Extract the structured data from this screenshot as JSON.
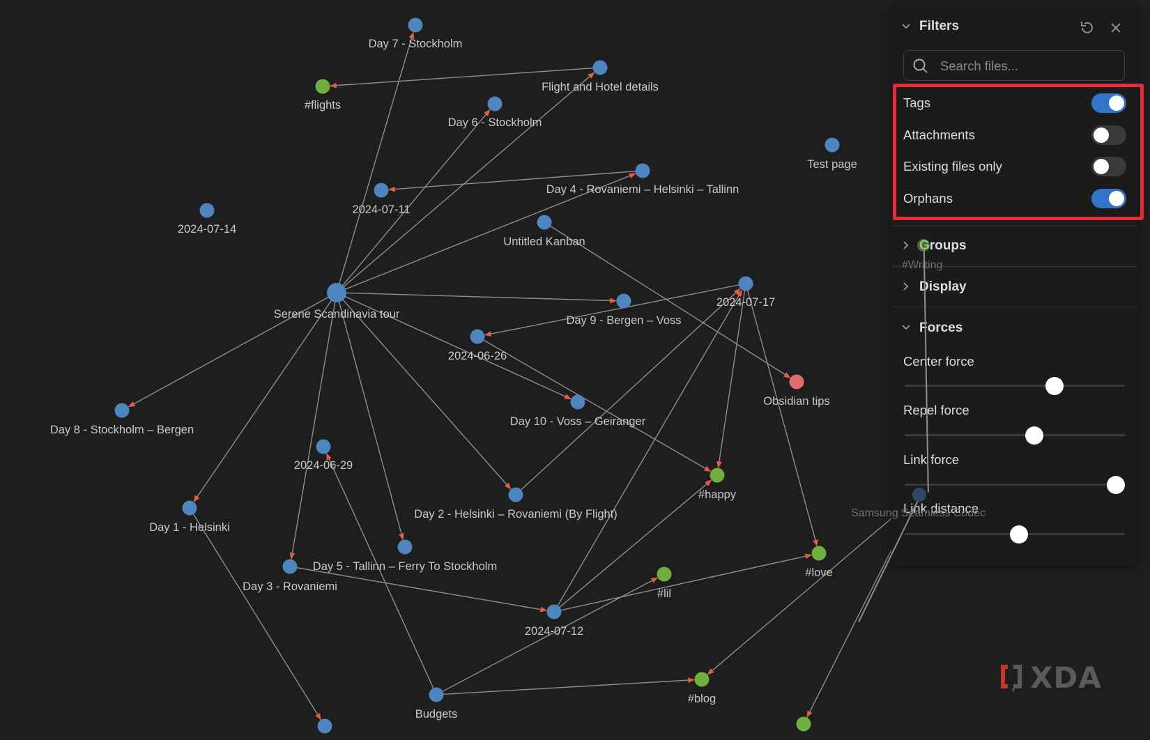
{
  "colors": {
    "background": "#1e1e1e",
    "node_note": "#4f86bf",
    "node_tag": "#6fae3f",
    "node_attachment": "#e06c6c",
    "edge": "#8f8f8f",
    "arrow": "#e05f45",
    "toggle_on": "#3274c7",
    "highlight_box": "#e8283b"
  },
  "graph": {
    "nodes": [
      {
        "id": "stockholm7",
        "label": "Day 7 - Stockholm",
        "kind": "note"
      },
      {
        "id": "flight",
        "label": "Flight and Hotel details",
        "kind": "note"
      },
      {
        "id": "flights",
        "label": "#flights",
        "kind": "tag"
      },
      {
        "id": "stockholm6",
        "label": "Day 6 - Stockholm",
        "kind": "note"
      },
      {
        "id": "d0711",
        "label": "2024-07-11",
        "kind": "note"
      },
      {
        "id": "day4",
        "label": "Day 4 - Rovaniemi – Helsinki – Tallinn",
        "kind": "note"
      },
      {
        "id": "testpage",
        "label": "Test page",
        "kind": "note"
      },
      {
        "id": "d0714",
        "label": "2024-07-14",
        "kind": "note"
      },
      {
        "id": "kanban",
        "label": "Untitled Kanban",
        "kind": "note"
      },
      {
        "id": "serene",
        "label": "Serene Scandinavia tour",
        "kind": "note",
        "hub": true
      },
      {
        "id": "day9",
        "label": "Day 9 - Bergen – Voss",
        "kind": "note"
      },
      {
        "id": "d0717",
        "label": "2024-07-17",
        "kind": "note"
      },
      {
        "id": "d0626",
        "label": "2024-06-26",
        "kind": "note"
      },
      {
        "id": "obsidian",
        "label": "Obsidian tips",
        "kind": "attachment"
      },
      {
        "id": "day10",
        "label": "Day 10 - Voss – Geiranger",
        "kind": "note"
      },
      {
        "id": "day8",
        "label": "Day 8 - Stockholm – Bergen",
        "kind": "note"
      },
      {
        "id": "d0629",
        "label": "2024-06-29",
        "kind": "note"
      },
      {
        "id": "day2",
        "label": "Day 2 - Helsinki – Rovaniemi (By Flight)",
        "kind": "note"
      },
      {
        "id": "happy",
        "label": "#happy",
        "kind": "tag"
      },
      {
        "id": "day1",
        "label": "Day 1 - Helsinki",
        "kind": "note"
      },
      {
        "id": "day5",
        "label": "Day 5 - Tallinn – Ferry To Stockholm",
        "kind": "note"
      },
      {
        "id": "day3",
        "label": "Day 3 - Rovaniemi",
        "kind": "note"
      },
      {
        "id": "love",
        "label": "#love",
        "kind": "tag"
      },
      {
        "id": "lil",
        "label": "#lil",
        "kind": "tag"
      },
      {
        "id": "d0712",
        "label": "2024-07-12",
        "kind": "note"
      },
      {
        "id": "blog",
        "label": "#blog",
        "kind": "tag"
      },
      {
        "id": "budgets",
        "label": "Budgets",
        "kind": "note"
      },
      {
        "id": "bottom1",
        "label": "",
        "kind": "note"
      },
      {
        "id": "bottom2",
        "label": "",
        "kind": "tag"
      }
    ],
    "edges": [
      [
        "serene",
        "stockholm7"
      ],
      [
        "serene",
        "stockholm6"
      ],
      [
        "serene",
        "flight"
      ],
      [
        "serene",
        "day4"
      ],
      [
        "serene",
        "day9"
      ],
      [
        "serene",
        "day8"
      ],
      [
        "serene",
        "day1"
      ],
      [
        "serene",
        "day3"
      ],
      [
        "serene",
        "day5"
      ],
      [
        "serene",
        "day2"
      ],
      [
        "serene",
        "day10"
      ],
      [
        "flight",
        "flights"
      ],
      [
        "day4",
        "d0711"
      ],
      [
        "kanban",
        "obsidian"
      ],
      [
        "d0717",
        "d0626"
      ],
      [
        "d0626",
        "happy"
      ],
      [
        "d0717",
        "happy"
      ],
      [
        "d0717",
        "love"
      ],
      [
        "day2",
        "d0717"
      ],
      [
        "d0712",
        "d0717"
      ],
      [
        "d0712",
        "happy"
      ],
      [
        "d0712",
        "love"
      ],
      [
        "day3",
        "d0712"
      ],
      [
        "budgets",
        "d0629"
      ],
      [
        "budgets",
        "lil"
      ],
      [
        "budgets",
        "blog"
      ],
      [
        "day1",
        "bottom1"
      ],
      [
        "samsung",
        "blog"
      ],
      [
        "samsung",
        "bottom2"
      ]
    ],
    "overlay_labels": {
      "writing": "#Writing",
      "samsung": "Samsung Seamless Codec"
    }
  },
  "filters": {
    "title": "Filters",
    "search_placeholder": "Search files...",
    "options": [
      {
        "label": "Tags",
        "on": true
      },
      {
        "label": "Attachments",
        "on": false
      },
      {
        "label": "Existing files only",
        "on": false
      },
      {
        "label": "Orphans",
        "on": true
      }
    ]
  },
  "groups": {
    "title": "Groups"
  },
  "display": {
    "title": "Display"
  },
  "forces": {
    "title": "Forces",
    "sliders": [
      {
        "label": "Center force",
        "value": 0.68
      },
      {
        "label": "Repel force",
        "value": 0.59
      },
      {
        "label": "Link force",
        "value": 0.96
      },
      {
        "label": "Link distance",
        "value": 0.52
      }
    ]
  },
  "watermark": {
    "brand": "XDA"
  }
}
